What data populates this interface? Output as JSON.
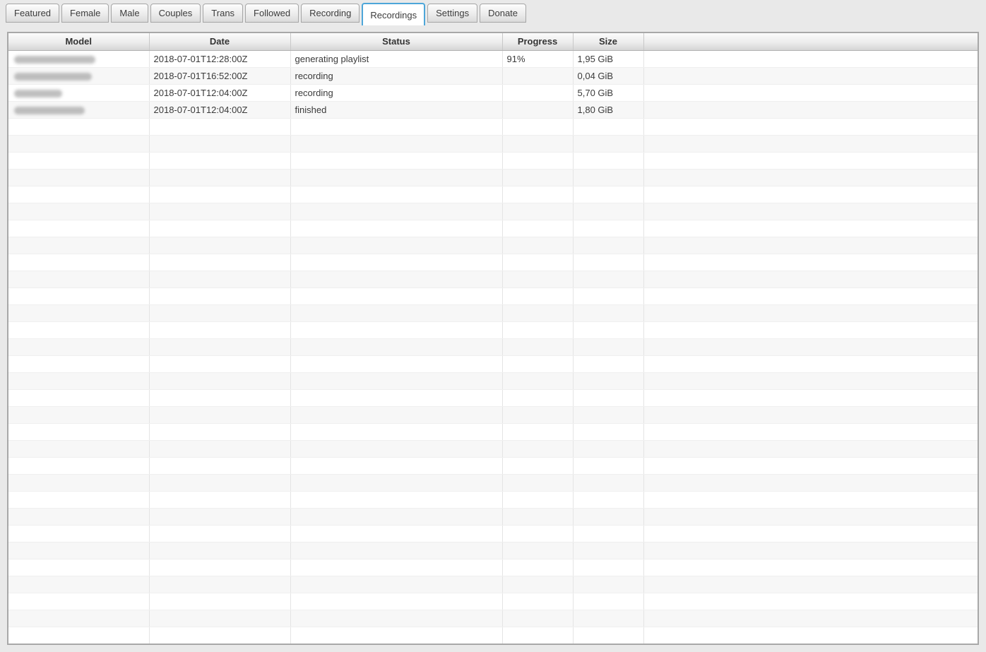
{
  "window": {
    "background_color": "#e9e9e9",
    "accent_color": "#4da6d9"
  },
  "tabs": {
    "items": [
      {
        "label": "Featured",
        "active": false
      },
      {
        "label": "Female",
        "active": false
      },
      {
        "label": "Male",
        "active": false
      },
      {
        "label": "Couples",
        "active": false
      },
      {
        "label": "Trans",
        "active": false
      },
      {
        "label": "Followed",
        "active": false
      },
      {
        "label": "Recording",
        "active": false
      },
      {
        "label": "Recordings",
        "active": true
      },
      {
        "label": "Settings",
        "active": false
      },
      {
        "label": "Donate",
        "active": false
      }
    ]
  },
  "recordings_table": {
    "columns": [
      "Model",
      "Date",
      "Status",
      "Progress",
      "Size",
      ""
    ],
    "rows": [
      {
        "model_redacted": true,
        "model_blur_width": 115,
        "date": "2018-07-01T12:28:00Z",
        "status": "generating playlist",
        "progress": "91%",
        "size": "1,95 GiB"
      },
      {
        "model_redacted": true,
        "model_blur_width": 110,
        "date": "2018-07-01T16:52:00Z",
        "status": "recording",
        "progress": "",
        "size": "0,04 GiB"
      },
      {
        "model_redacted": true,
        "model_blur_width": 68,
        "date": "2018-07-01T12:04:00Z",
        "status": "recording",
        "progress": "",
        "size": "5,70 GiB"
      },
      {
        "model_redacted": true,
        "model_blur_width": 100,
        "date": "2018-07-01T12:04:00Z",
        "status": "finished",
        "progress": "",
        "size": "1,80 GiB"
      }
    ],
    "empty_row_count": 31
  }
}
